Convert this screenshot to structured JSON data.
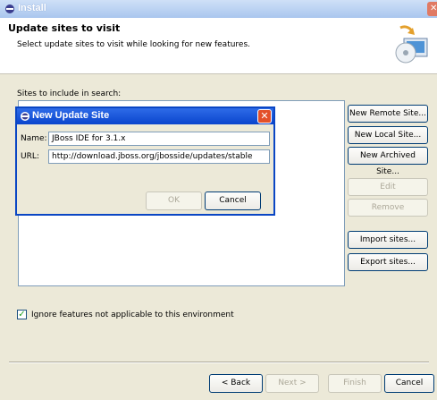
{
  "window": {
    "title": "Install",
    "header_title": "Update sites to visit",
    "header_desc": "Select update sites to visit while looking for new features.",
    "sites_label": "Sites to include in search:",
    "buttons": {
      "new_remote": "New Remote Site...",
      "new_local": "New Local Site...",
      "new_archived": "New Archived Site...",
      "edit": "Edit",
      "remove": "Remove",
      "import": "Import sites...",
      "export": "Export sites..."
    },
    "checkbox": {
      "label": "Ignore features not applicable to this environment",
      "checked": true
    },
    "footer": {
      "back": "< Back",
      "next": "Next >",
      "finish": "Finish",
      "cancel": "Cancel"
    }
  },
  "dialog": {
    "title": "New Update Site",
    "name_label": "Name:",
    "name_value": "JBoss IDE for 3.1.x",
    "url_label": "URL:",
    "url_value": "http://download.jboss.org/jbosside/updates/stable",
    "ok": "OK",
    "cancel": "Cancel"
  }
}
